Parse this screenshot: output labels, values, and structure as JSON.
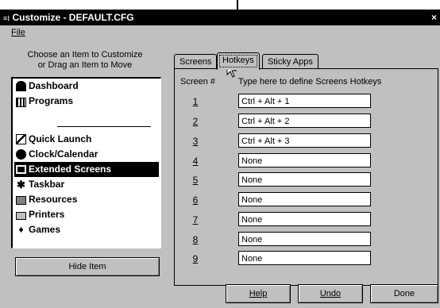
{
  "window": {
    "title": "Customize - DEFAULT.CFG",
    "close_glyph": "×",
    "title_icon": "customize-app-icon"
  },
  "menu": {
    "file": "File"
  },
  "left": {
    "heading_line1": "Choose an Item to Customize",
    "heading_line2": "or Drag an Item to Move",
    "items": [
      {
        "label": "Dashboard",
        "icon": "dashboard-icon"
      },
      {
        "label": "Programs",
        "icon": "programs-icon"
      },
      {
        "label": "Quick Launch",
        "icon": "quick-launch-icon"
      },
      {
        "label": "Clock/Calendar",
        "icon": "clock-icon"
      },
      {
        "label": "Extended Screens",
        "icon": "extended-screens-icon",
        "selected": true
      },
      {
        "label": "Taskbar",
        "icon": "taskbar-icon"
      },
      {
        "label": "Resources",
        "icon": "resources-icon"
      },
      {
        "label": "Printers",
        "icon": "printers-icon"
      },
      {
        "label": "Games",
        "icon": "games-icon"
      }
    ],
    "hide_button": "Hide Item"
  },
  "tabs": [
    {
      "label": "Screens"
    },
    {
      "label": "Hotkeys",
      "active": true
    },
    {
      "label": "Sticky Apps"
    }
  ],
  "hotkeys": {
    "col_screen": "Screen #",
    "col_define": "Type here to define Screens Hotkeys",
    "rows": [
      {
        "num": "1",
        "value": "Ctrl + Alt + 1"
      },
      {
        "num": "2",
        "value": "Ctrl + Alt + 2"
      },
      {
        "num": "3",
        "value": "Ctrl + Alt + 3"
      },
      {
        "num": "4",
        "value": "None"
      },
      {
        "num": "5",
        "value": "None"
      },
      {
        "num": "6",
        "value": "None"
      },
      {
        "num": "7",
        "value": "None"
      },
      {
        "num": "8",
        "value": "None"
      },
      {
        "num": "9",
        "value": "None"
      }
    ]
  },
  "buttons": {
    "help": "Help",
    "undo": "Undo",
    "done": "Done"
  }
}
